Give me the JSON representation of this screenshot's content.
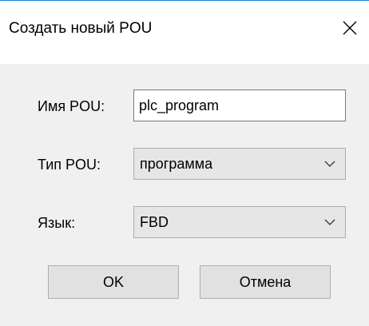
{
  "window": {
    "title": "Создать новый POU"
  },
  "form": {
    "name_label": "Имя POU:",
    "name_value": "plc_program",
    "type_label": "Тип POU:",
    "type_value": "программа",
    "lang_label": "Язык:",
    "lang_value": "FBD"
  },
  "buttons": {
    "ok_label": "OK",
    "cancel_label": "Отмена"
  },
  "icons": {
    "close": "close-icon",
    "dropdown": "chevron-down-icon"
  },
  "colors": {
    "title_accent": "#1883d7",
    "dialog_background": "#f0f0f0"
  }
}
